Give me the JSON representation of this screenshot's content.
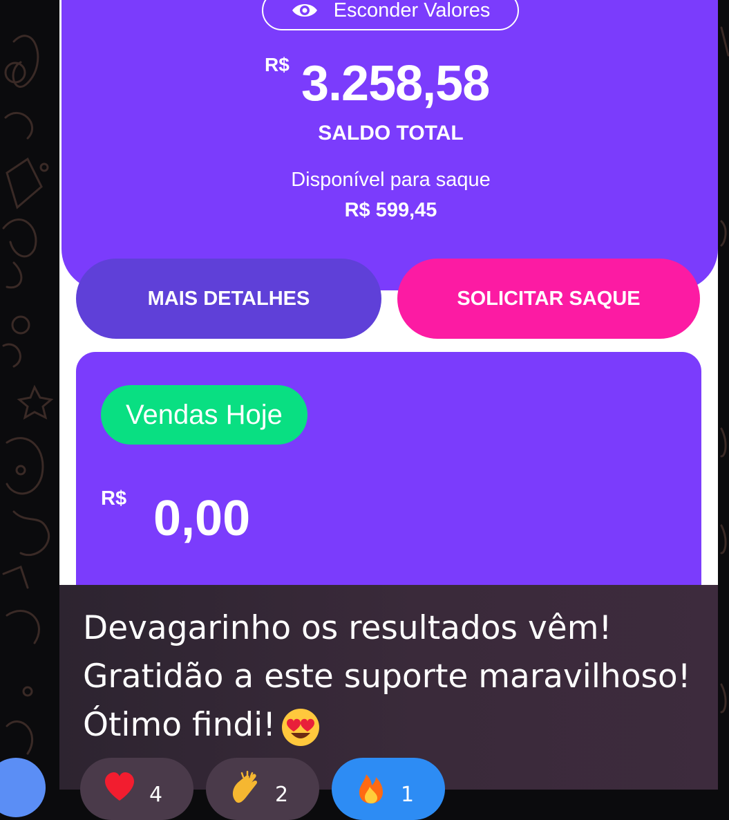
{
  "balance": {
    "hide_values_label": "Esconder Valores",
    "currency_symbol": "R$",
    "total_value": "3.258,58",
    "total_label": "SALDO TOTAL",
    "available_label": "Disponível para saque",
    "available_value": "R$ 599,45"
  },
  "actions": {
    "details_label": "MAIS DETALHES",
    "withdraw_label": "SOLICITAR SAQUE"
  },
  "sales_today": {
    "badge_label": "Vendas Hoje",
    "currency_symbol": "R$",
    "value": "0,00"
  },
  "message": {
    "lines": [
      "Devagarinho os resultados vêm!",
      "Gratidão a este suporte maravilhoso!",
      "Ótimo findi!"
    ],
    "inline_emoji": "heart-eyes-emoji"
  },
  "reactions": [
    {
      "icon": "heart-icon",
      "count": "4"
    },
    {
      "icon": "clapping-hands-icon",
      "count": "2"
    },
    {
      "icon": "fire-icon",
      "count": "1"
    }
  ],
  "colors": {
    "brand_purple": "#7b3cfc",
    "details_button": "#5f40d8",
    "withdraw_button": "#fc1ba3",
    "sales_badge": "#09df82",
    "reaction_active": "#2d8cf4"
  }
}
